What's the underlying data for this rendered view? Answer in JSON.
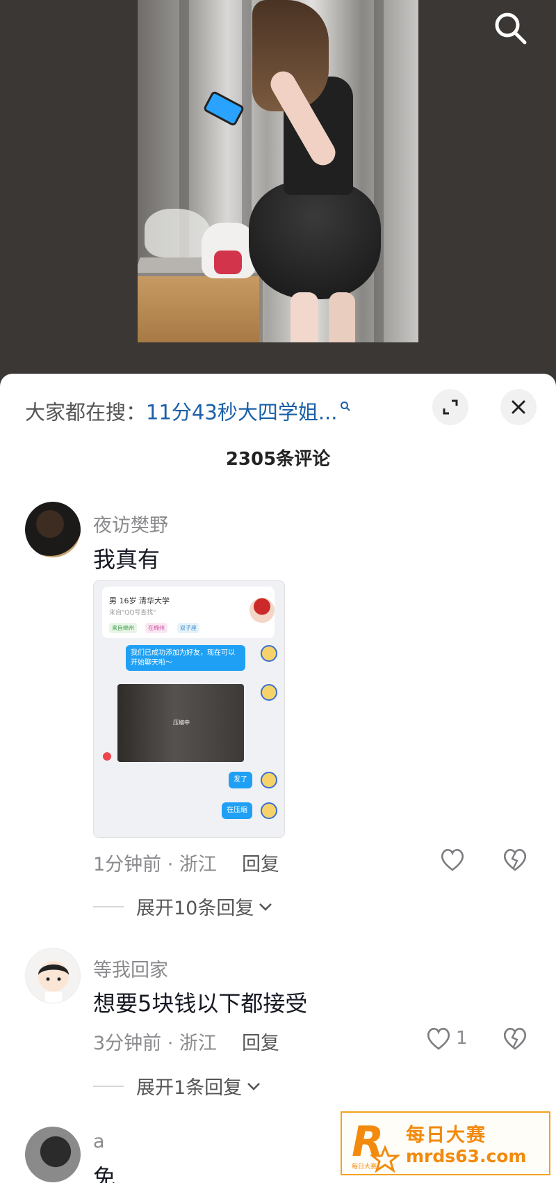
{
  "video": {
    "description_hidden": ""
  },
  "sheet": {
    "hot_search_prefix": "大家都在搜：",
    "hot_search_keyword": "11分43秒大四学姐...",
    "comment_count": "2305条评论"
  },
  "comments": [
    {
      "user": "夜访樊野",
      "text": "我真有",
      "time_location": "1分钟前 · 浙江",
      "reply_label": "回复",
      "expand_label": "展开10条回复",
      "like_count": "",
      "screenshot": {
        "profile_line": "男  16岁  清华大学",
        "profile_sub": "来自\"QQ号查找\"",
        "tags": [
          "来自绵州",
          "在绵州",
          "双子座"
        ],
        "bubble1": "我们已成功添加为好友，现在可以开始聊天啦～",
        "photo_label": "压缩中",
        "bubble2": "发了",
        "bubble3": "在压缩"
      }
    },
    {
      "user": "等我回家",
      "text": "想要5块钱以下都接受",
      "time_location": "3分钟前 · 浙江",
      "reply_label": "回复",
      "expand_label": "展开1条回复",
      "like_count": "1"
    },
    {
      "user": "a",
      "text": "免"
    }
  ],
  "watermark": {
    "logo_letter": "R",
    "logo_sub": "每日大赛",
    "title": "每日大赛",
    "url": "mrds63.com"
  },
  "colors": {
    "keyword": "#1a5fa8",
    "watermark": "#f28a0d",
    "bubble": "#1fa0f5"
  }
}
